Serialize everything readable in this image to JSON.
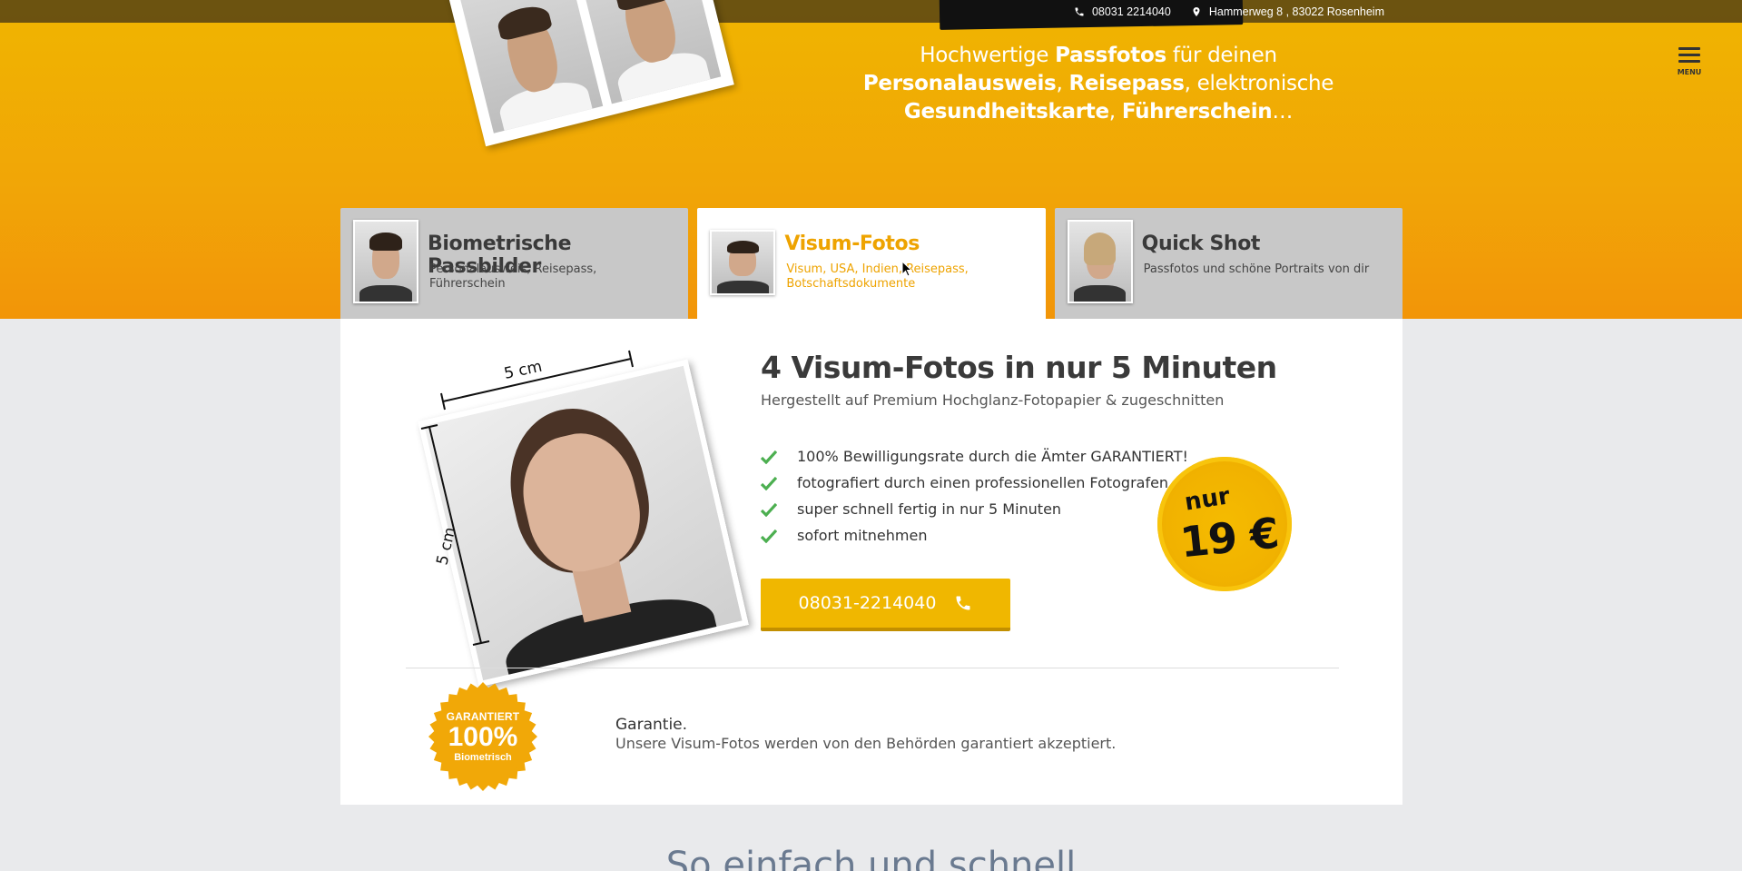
{
  "topbar": {
    "phone": "08031 2214040",
    "address": "Hammerweg 8 , 83022 Rosenheim"
  },
  "hero": {
    "text_parts": [
      {
        "t": "Hochwertige ",
        "b": false
      },
      {
        "t": "Passfotos",
        "b": true
      },
      {
        "t": " für deinen ",
        "b": false
      },
      {
        "t": "Personalausweis",
        "b": true
      },
      {
        "t": ", ",
        "b": false
      },
      {
        "t": "Reisepass",
        "b": true
      },
      {
        "t": ", elektronische ",
        "b": false
      },
      {
        "t": "Gesundheitskarte",
        "b": true
      },
      {
        "t": ", ",
        "b": false
      },
      {
        "t": "Führerschein",
        "b": true
      },
      {
        "t": "…",
        "b": false
      }
    ],
    "menu_label": "MENU"
  },
  "tabs": [
    {
      "title": "Biometrische Passbilder",
      "sub": "Personalausweis, Reisepass, Führerschein",
      "active": false
    },
    {
      "title": "Visum-Fotos",
      "sub": "Visum, USA, Indien, Reisepass, Botschaftsdokumente",
      "active": true
    },
    {
      "title": "Quick Shot",
      "sub": "Passfotos und schöne Portraits von dir",
      "active": false
    }
  ],
  "product": {
    "dimension_top": "5 cm",
    "dimension_side": "5 cm",
    "headline": "4 Visum-Fotos in nur 5 Minuten",
    "subline": "Hergestellt auf Premium Hochglanz-Fotopapier & zugeschnitten",
    "features": [
      "100% Bewilligungsrate durch die Ämter GARANTIERT!",
      "fotografiert durch einen professionellen Fotografen",
      "super schnell fertig in nur 5 Minuten",
      "sofort mitnehmen"
    ],
    "price_prefix": "nur",
    "price": "19 €",
    "call_label": "08031-2214040"
  },
  "guarantee": {
    "seal_top": "GARANTIERT",
    "seal_mid": "100%",
    "seal_bottom": "Biometrisch",
    "title": "Garantie.",
    "text": "Unsere Visum-Fotos werden von den Behörden garantiert akzeptiert."
  },
  "next_section_title": "So einfach und schnell",
  "colors": {
    "accent": "#f0b700",
    "check": "#4caf50"
  }
}
